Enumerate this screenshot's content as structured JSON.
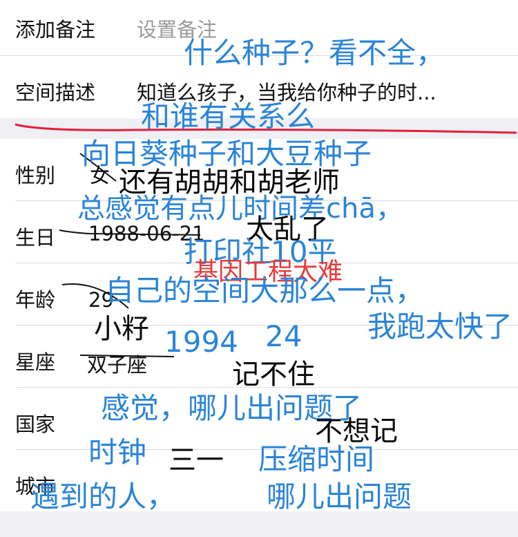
{
  "rows": {
    "remark": {
      "label": "添加备注",
      "value": "设置备注"
    },
    "description": {
      "label": "空间描述",
      "value": "知道么孩子，当我给你种子的时..."
    },
    "gender": {
      "label": "性别",
      "value": "女"
    },
    "birthday": {
      "label": "生日",
      "value": "1988-06-21"
    },
    "age": {
      "label": "年龄",
      "value": "29"
    },
    "zodiac": {
      "label": "星座",
      "value": "双子座"
    },
    "country": {
      "label": "国家"
    },
    "city": {
      "label": "城市"
    }
  },
  "annotations": {
    "a1": "什么种子？看不全，",
    "a2": "和谁有关系么",
    "a3": "向日葵种子和大豆种子",
    "a4": "还有胡胡和胡老师",
    "a5": "总感觉有点儿时间差chā，",
    "a6": "太乱了",
    "a7": "打印社10平",
    "a8": "基因工程太难",
    "a9": "自己的空间大那么一点，",
    "a10": "我跑太快了",
    "a11": "小籽",
    "a12": "1994",
    "a13": "24",
    "a14": "记不住",
    "a15": "感觉，哪儿出问题了",
    "a16": "不想记",
    "a17": "时钟",
    "a18": "三一",
    "a19": "压缩时间",
    "a20": "遇到的人，",
    "a21": "哪儿出问题"
  },
  "colors": {
    "annotation_blue": "#2a84d8",
    "annotation_red": "#e63a3a",
    "annotation_black": "#0a0a0a",
    "underline_red": "#e0203a",
    "section_gray": "#efeff4",
    "placeholder_gray": "#9a9a9a"
  }
}
